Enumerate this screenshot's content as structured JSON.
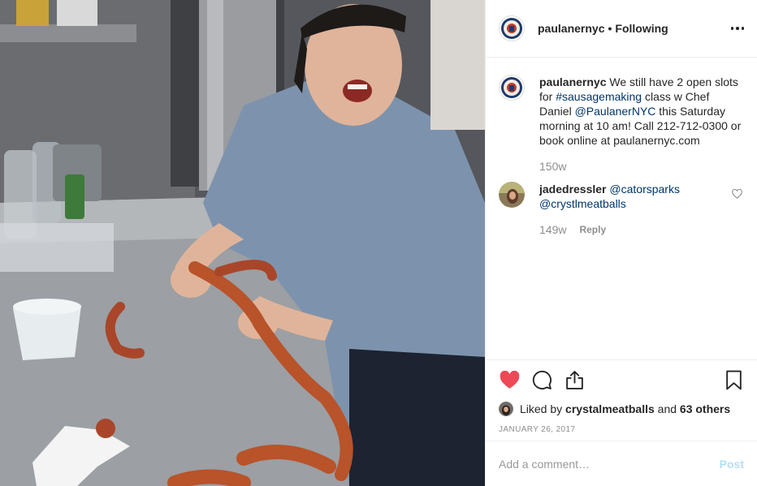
{
  "post": {
    "photo_icon": "photo-woman-making-sausages",
    "header": {
      "username": "paulanernyc",
      "separator": "•",
      "follow_status": "Following",
      "more_icon": "more-options-icon"
    },
    "caption": {
      "username": "paulanernyc",
      "text_1": " We still have 2 open slots for ",
      "hashtag": "#sausagemaking",
      "text_2": " class w Chef Daniel ",
      "mention": "@PaulanerNYC",
      "text_3": " this Saturday morning at 10 am! Call 212-712-0300 or book online at paulanernyc.com",
      "age": "150w"
    },
    "comments": [
      {
        "username": "jadedressler",
        "mention_1": "@catorsparks",
        "mention_2": "@crystlmeatballs",
        "age": "149w",
        "reply_label": "Reply"
      }
    ],
    "actions": {
      "like_icon": "heart-filled-icon",
      "comment_icon": "comment-icon",
      "share_icon": "share-icon",
      "save_icon": "bookmark-icon",
      "like_color": "#ed4956"
    },
    "likes": {
      "prefix": "Liked by ",
      "user": "crystalmeatballs",
      "middle": " and ",
      "others": "63 others"
    },
    "date": "JANUARY 26, 2017",
    "add_comment": {
      "placeholder": "Add a comment…",
      "post_label": "Post"
    }
  }
}
